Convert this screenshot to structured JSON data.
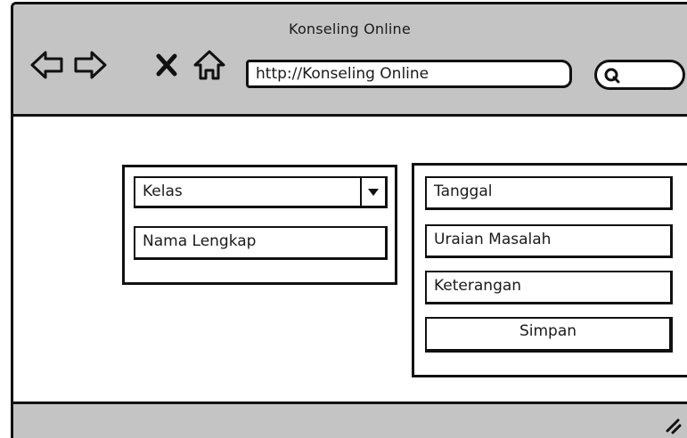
{
  "window": {
    "title": "Konseling Online"
  },
  "toolbar": {
    "url": "http://Konseling Online",
    "nav_icons": [
      "back-arrow-icon",
      "forward-arrow-icon",
      "close-x-icon",
      "home-icon"
    ],
    "search_icon": "search-icon"
  },
  "form_left": {
    "kelas_select": {
      "value": "Kelas"
    },
    "nama_field": {
      "value": "Nama Lengkap"
    }
  },
  "form_right": {
    "tanggal_field": {
      "value": "Tanggal"
    },
    "uraian_field": {
      "value": "Uraian Masalah"
    },
    "keterangan_field": {
      "value": "Keterangan"
    },
    "simpan_button": {
      "label": "Simpan"
    }
  },
  "colors": {
    "chrome": "#c4c4c4",
    "border": "#111111",
    "background": "#ffffff"
  }
}
